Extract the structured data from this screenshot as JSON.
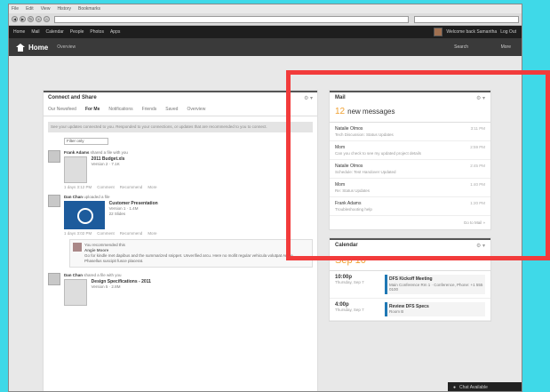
{
  "menubar": {
    "items": [
      "File",
      "Edit",
      "View",
      "History",
      "Bookmarks"
    ]
  },
  "topnav": {
    "items": [
      "Home",
      "Mail",
      "Calendar",
      "People",
      "Photos",
      "Apps"
    ],
    "user": "Welcome back Samantha",
    "logout": "Log Out"
  },
  "banner": {
    "title": "Home",
    "subtitle": "Overview",
    "search": "Search",
    "more": "More"
  },
  "feed": {
    "title": "Connect and Share",
    "tabs": [
      "Our Newsfeed",
      "For Me",
      "Notifications",
      "Friends",
      "Saved",
      "Overview"
    ],
    "active_tab": "For Me",
    "info": "See your updates connected to you. Responded to your connections, or updates that are recommended to you to connect.",
    "filter": "Filter only",
    "entries": [
      {
        "who": "Frank Adams",
        "action": "shared a file with you",
        "file": "2011 Budget.xls",
        "meta": "Version 2 · 7.1K",
        "time": "1 days 3:12 PM",
        "actions": [
          "Comment",
          "Recommend",
          "More"
        ]
      },
      {
        "who": "Dan Chan",
        "action": "uploaded a file",
        "file": "Customer Presentation",
        "meta": "Version 1 · 1.4M",
        "extra": "22 Slides",
        "time": "1 days 3:02 PM",
        "actions": [
          "Comment",
          "Recommend",
          "More"
        ]
      },
      {
        "comment_head": "You recommended this",
        "commenter": "Angie Moore",
        "comment": "Go for kindle met dapibus and the summarized snippet. Unverified arcu. Here no mollit regular vehicula volutpat Angie. Phasellus suscipit fusce placerat."
      },
      {
        "who": "Dan Chan",
        "action": "shared a file with you",
        "file": "Design Specifications - 2011",
        "meta": "Version 5 · 2.8M",
        "time": "1 days 1:55 PM",
        "actions": [
          "Comment",
          "Recommend",
          "More"
        ]
      }
    ]
  },
  "mail": {
    "title": "Mail",
    "new_count": "12",
    "new_label": "new messages",
    "messages": [
      {
        "from": "Natalie Olmos",
        "subject": "Tech Discussion: Status Updates",
        "time": "3:11 PM"
      },
      {
        "from": "Mom",
        "subject": "Can you check to see my updated project details",
        "time": "2:59 PM"
      },
      {
        "from": "Natalie Olmos",
        "subject": "Schedule: Test Handover Updated",
        "time": "2:45 PM"
      },
      {
        "from": "Mom",
        "subject": "Re: Status Updates",
        "time": "1:40 PM"
      },
      {
        "from": "Frank Adams",
        "subject": "Troubleshooting help",
        "time": "1:20 PM"
      }
    ],
    "more": "Go to Mail »"
  },
  "calendar": {
    "title": "Calendar",
    "date": "Sep 10",
    "events": [
      {
        "time": "10:00p",
        "day": "Thursday, Sep 7",
        "title": "DFS Kickoff Meeting",
        "detail": "Main Conference Rm 1 · Conference, Phone: +1 555 0100"
      },
      {
        "time": "4:00p",
        "day": "Thursday, Sep 7",
        "title": "Review DFS Specs",
        "detail": "Room B"
      }
    ]
  },
  "chat": {
    "label": "Chat Available"
  }
}
